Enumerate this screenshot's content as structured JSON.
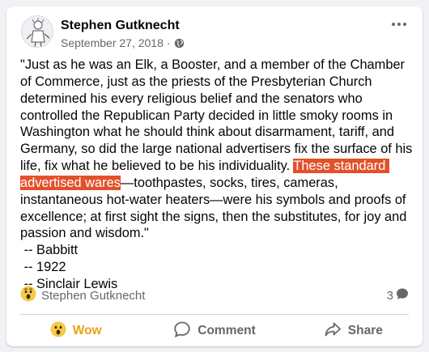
{
  "post": {
    "author": "Stephen Gutknecht",
    "date": "September 27, 2018",
    "separator": "·",
    "privacy_icon": "public-globe-icon",
    "text_before": "\"Just as he was an Elk, a Booster, and a member of the Chamber of Commerce, just as the priests of the Presbyterian Church determined his every religious belief and the senators who controlled the Republican Party decided in little smoky rooms in Washington what he should think about disarmament, tariff, and Germany, so did the large national advertisers fix the surface of his life, fix what he believed to be his individuality. ",
    "text_highlight": "These standard advertised wares",
    "text_after": "—toothpastes, socks, tires, cameras, instantaneous hot-water heaters—were his symbols and proofs of excellence; at first sight the signs, then the substitutes, for joy and passion and wisdom.\"\n -- Babbitt\n -- 1922\n -- Sinclair Lewis",
    "highlight_color": "#e2512b"
  },
  "reactions": {
    "icon": "wow-reaction-icon",
    "reactor_name": "Stephen Gutknecht",
    "comment_count": "3",
    "comment_icon": "comment-bubble-icon"
  },
  "actions": {
    "wow_label": "Wow",
    "comment_label": "Comment",
    "share_label": "Share",
    "wow_color": "#e8a317",
    "text_color": "#65676b"
  }
}
